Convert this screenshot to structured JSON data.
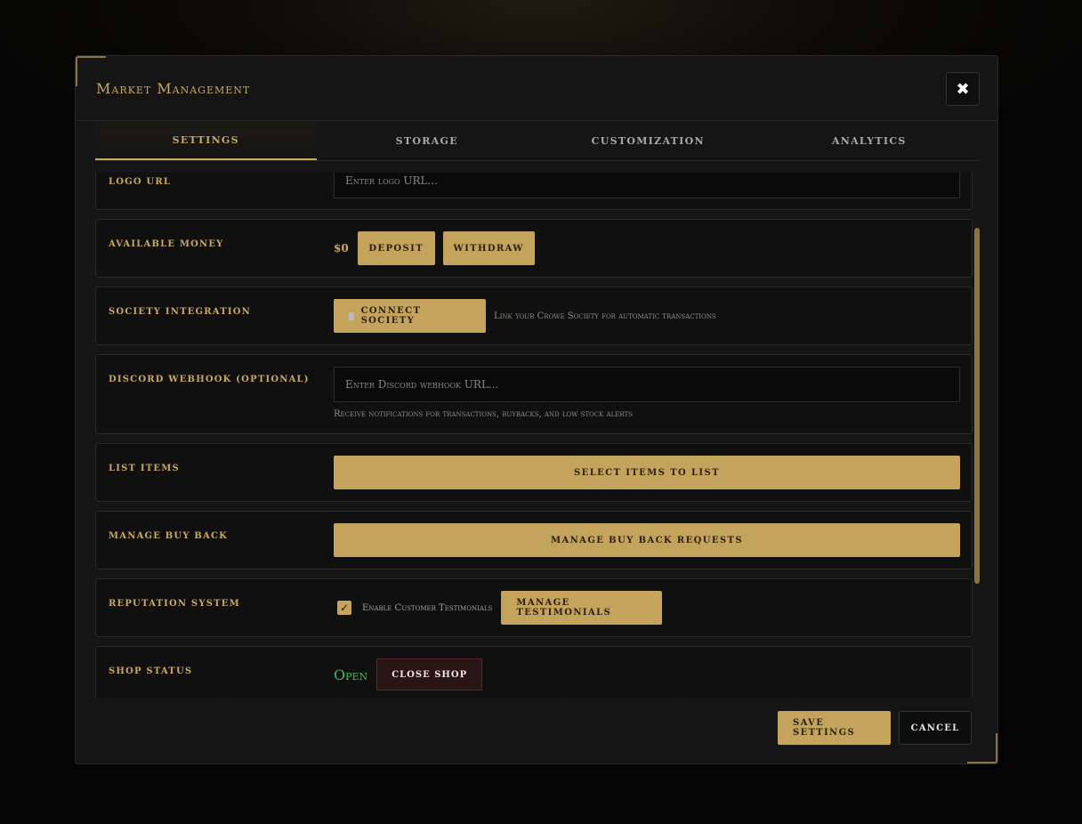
{
  "modal": {
    "title": "Market Management",
    "close_icon": "✖"
  },
  "tabs": [
    {
      "label": "Settings",
      "active": true
    },
    {
      "label": "Storage",
      "active": false
    },
    {
      "label": "Customization",
      "active": false
    },
    {
      "label": "Analytics",
      "active": false
    }
  ],
  "rows": {
    "logo_url": {
      "label": "Logo URL",
      "placeholder": "Enter logo URL..."
    },
    "available_money": {
      "label": "Available Money",
      "amount": "$0",
      "deposit_label": "Deposit",
      "withdraw_label": "Withdraw"
    },
    "society_integration": {
      "label": "Society Integration",
      "button_label": "Connect Society",
      "hint": "Link your Crowe Society for automatic transactions"
    },
    "discord_webhook": {
      "label": "Discord Webhook (Optional)",
      "placeholder": "Enter Discord webhook URL...",
      "hint": "Receive notifications for transactions, buybacks, and low stock alerts"
    },
    "list_items": {
      "label": "List Items",
      "button_label": "Select Items to List"
    },
    "manage_buy_back": {
      "label": "Manage Buy Back",
      "button_label": "Manage Buy Back Requests"
    },
    "reputation_system": {
      "label": "Reputation System",
      "checkbox_label": "Enable Customer Testimonials",
      "checked": true,
      "button_label": "Manage Testimonials"
    },
    "shop_status": {
      "label": "Shop Status",
      "status": "Open",
      "button_label": "CLOSE SHOP"
    }
  },
  "footer": {
    "save_label": "Save Settings",
    "cancel_label": "Cancel"
  },
  "colors": {
    "accent": "#c4a45c",
    "open_status": "#3fbf5f",
    "background": "#151515"
  }
}
